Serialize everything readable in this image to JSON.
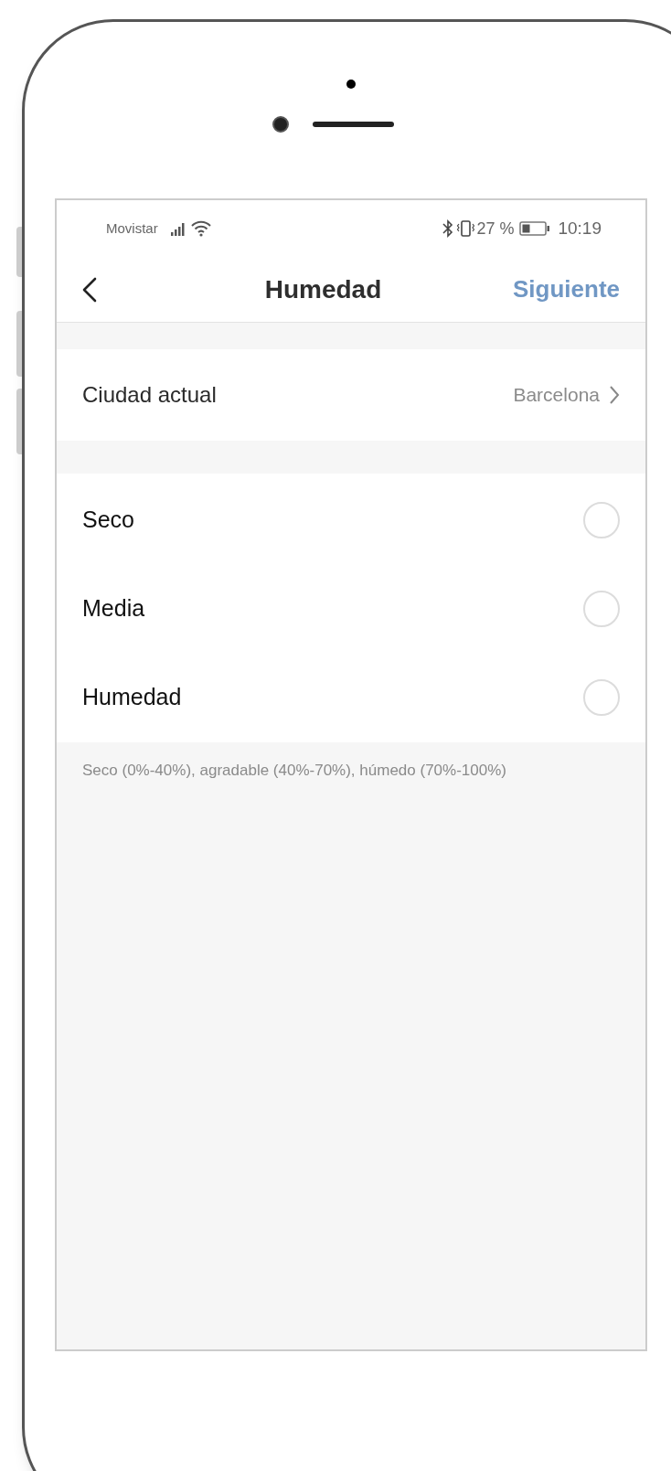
{
  "status_bar": {
    "carrier": "Movistar",
    "battery_text": "27 %",
    "time": "10:19"
  },
  "nav": {
    "title": "Humedad",
    "action": "Siguiente"
  },
  "city": {
    "label": "Ciudad actual",
    "value": "Barcelona"
  },
  "options": [
    {
      "label": "Seco",
      "selected": false
    },
    {
      "label": "Media",
      "selected": false
    },
    {
      "label": "Humedad",
      "selected": false
    }
  ],
  "footnote": "Seco (0%-40%), agradable (40%-70%), húmedo (70%-100%)"
}
